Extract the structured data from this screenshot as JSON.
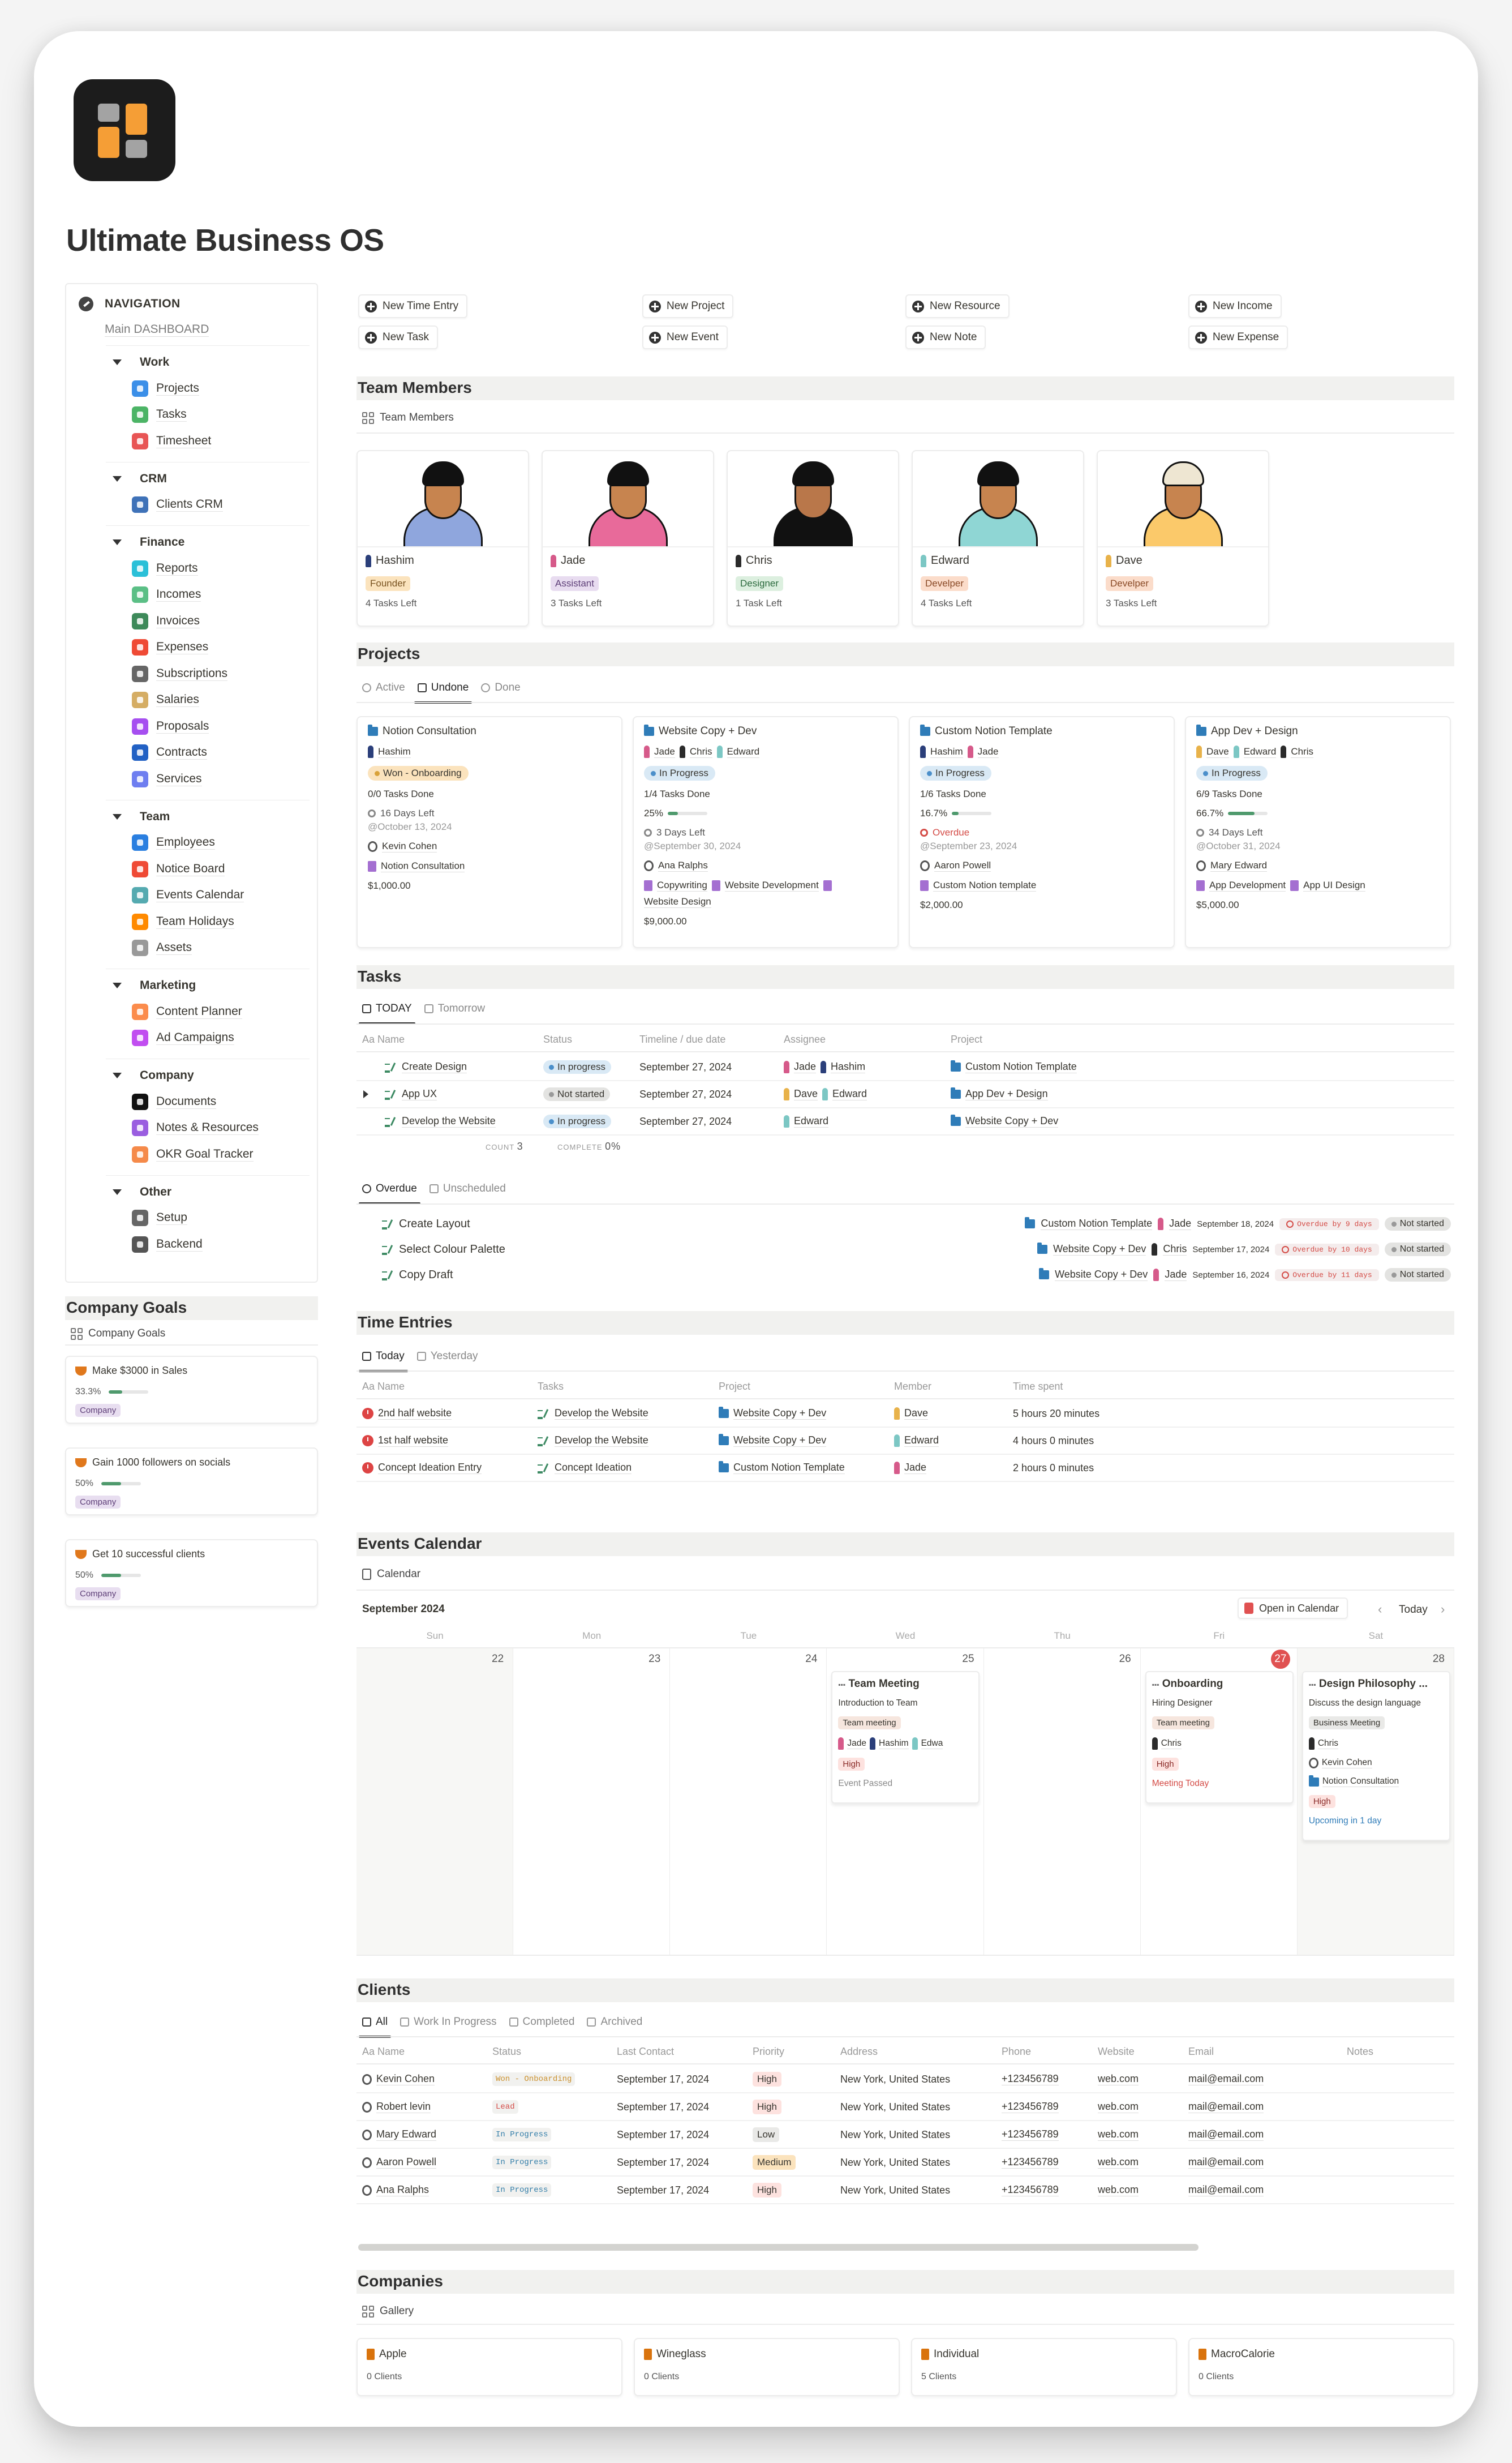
{
  "page": {
    "title": "Ultimate Business OS"
  },
  "navigation": {
    "heading": "NAVIGATION",
    "subtitle": "Main DASHBOARD",
    "groups": [
      {
        "title": "Work",
        "items": [
          {
            "label": "Projects",
            "icon": "projects-icon",
            "color": "#3b8fe8"
          },
          {
            "label": "Tasks",
            "icon": "tasks-icon",
            "color": "#4cb466"
          },
          {
            "label": "Timesheet",
            "icon": "timesheet-icon",
            "color": "#e85555"
          }
        ]
      },
      {
        "title": "CRM",
        "items": [
          {
            "label": "Clients CRM",
            "icon": "clients-icon",
            "color": "#3f72b8"
          }
        ]
      },
      {
        "title": "Finance",
        "items": [
          {
            "label": "Reports",
            "icon": "reports-icon",
            "color": "#2bc0d8"
          },
          {
            "label": "Incomes",
            "icon": "incomes-icon",
            "color": "#5bbf86"
          },
          {
            "label": "Invoices",
            "icon": "invoices-icon",
            "color": "#3e8a5a"
          },
          {
            "label": "Expenses",
            "icon": "expenses-icon",
            "color": "#ef4a35"
          },
          {
            "label": "Subscriptions",
            "icon": "subscriptions-icon",
            "color": "#666666"
          },
          {
            "label": "Salaries",
            "icon": "salaries-icon",
            "color": "#d5ad64"
          },
          {
            "label": "Proposals",
            "icon": "proposals-icon",
            "color": "#a64ff0"
          },
          {
            "label": "Contracts",
            "icon": "contracts-icon",
            "color": "#2261c4"
          },
          {
            "label": "Services",
            "icon": "services-icon",
            "color": "#6e7ef0"
          }
        ]
      },
      {
        "title": "Team",
        "items": [
          {
            "label": "Employees",
            "icon": "employees-icon",
            "color": "#2a7fe0"
          },
          {
            "label": "Notice Board",
            "icon": "notice-board-icon",
            "color": "#ef4a35"
          },
          {
            "label": "Events Calendar",
            "icon": "events-calendar-icon",
            "color": "#55aab0"
          },
          {
            "label": "Team Holidays",
            "icon": "team-holidays-icon",
            "color": "#ff8a00"
          },
          {
            "label": "Assets",
            "icon": "assets-icon",
            "color": "#999999"
          }
        ]
      },
      {
        "title": "Marketing",
        "items": [
          {
            "label": "Content Planner",
            "icon": "content-planner-icon",
            "color": "#fb8c4c"
          },
          {
            "label": "Ad Campaigns",
            "icon": "ad-campaigns-icon",
            "color": "#c14ef0"
          }
        ]
      },
      {
        "title": "Company",
        "items": [
          {
            "label": "Documents",
            "icon": "documents-icon",
            "color": "#111111"
          },
          {
            "label": "Notes & Resources",
            "icon": "notes-resources-icon",
            "color": "#9a5ee0"
          },
          {
            "label": "OKR Goal Tracker",
            "icon": "okr-goal-tracker-icon",
            "color": "#f58a4a"
          }
        ]
      },
      {
        "title": "Other",
        "items": [
          {
            "label": "Setup",
            "icon": "setup-icon",
            "color": "#666666"
          },
          {
            "label": "Backend",
            "icon": "database-icon",
            "color": "#555555"
          }
        ]
      }
    ]
  },
  "goals": {
    "title": "Company Goals",
    "view": "Company Goals",
    "items": [
      {
        "label": "Make $3000 in Sales",
        "percent_text": "33.3%",
        "progress": 0.333,
        "tag": "Company"
      },
      {
        "label": "Gain 1000 followers on socials",
        "percent_text": "50%",
        "progress": 0.5,
        "tag": "Company"
      },
      {
        "label": "Get 10 successful clients",
        "percent_text": "50%",
        "progress": 0.5,
        "tag": "Company"
      }
    ]
  },
  "quick_actions": [
    [
      "New Time Entry",
      "New Task"
    ],
    [
      "New Project",
      "New Event"
    ],
    [
      "New Resource",
      "New Note"
    ],
    [
      "New Income",
      "New Expense"
    ]
  ],
  "team": {
    "title": "Team Members",
    "view": "Team Members",
    "members": [
      {
        "name": "Hashim",
        "role": "Founder",
        "role_bg": "#fbe3bd",
        "role_fg": "#7a5422",
        "tasks": "4 Tasks Left",
        "shirt": "#8fa6dd",
        "skin": "#c7844f",
        "hair": "#111"
      },
      {
        "name": "Jade",
        "role": "Assistant",
        "role_bg": "#e8dcf0",
        "role_fg": "#5e3f78",
        "tasks": "3 Tasks Left",
        "shirt": "#e86a9a",
        "skin": "#c7844f",
        "hair": "#111"
      },
      {
        "name": "Chris",
        "role": "Designer",
        "role_bg": "#dcefdf",
        "role_fg": "#2d6b3f",
        "tasks": "1 Task Left",
        "shirt": "#111",
        "skin": "#b9774a",
        "hair": "#111"
      },
      {
        "name": "Edward",
        "role": "Develper",
        "role_bg": "#fbdcca",
        "role_fg": "#8a4a27",
        "tasks": "4 Tasks Left",
        "shirt": "#8fd6d4",
        "skin": "#c7844f",
        "hair": "#111"
      },
      {
        "name": "Dave",
        "role": "Develper",
        "role_bg": "#fbdcca",
        "role_fg": "#8a4a27",
        "tasks": "3 Tasks Left",
        "shirt": "#fbc96a",
        "skin": "#c7844f",
        "hair": "#eee6d2"
      }
    ]
  },
  "projects": {
    "title": "Projects",
    "tabs": [
      "Active",
      "Undone",
      "Done"
    ],
    "active_tab": "Undone",
    "cards": [
      {
        "name": "Notion Consultation",
        "people": [
          "Hashim"
        ],
        "status": "Won - Onboarding",
        "status_bg": "#fbe3bd",
        "status_dot": "#d9a23a",
        "tasks_done": "0/0 Tasks Done",
        "progress": null,
        "deadline": "16 Days Left",
        "deadline_red": false,
        "date": "@October 13, 2024",
        "client": "Kevin Cohen",
        "services": [
          "Notion Consultation"
        ],
        "amount": "$1,000.00"
      },
      {
        "name": "Website Copy + Dev",
        "people": [
          "Jade",
          "Chris",
          "Edward"
        ],
        "status": "In Progress",
        "status_bg": "#d9e9f5",
        "status_dot": "#4b8fca",
        "tasks_done": "1/4 Tasks Done",
        "progress_text": "25%",
        "progress": 0.25,
        "deadline": "3 Days Left",
        "deadline_red": false,
        "date": "@September 30, 2024",
        "client": "Ana Ralphs",
        "services": [
          "Copywriting",
          "Website Development",
          "Website Design"
        ],
        "amount": "$9,000.00"
      },
      {
        "name": "Custom Notion Template",
        "people": [
          "Hashim",
          "Jade"
        ],
        "status": "In Progress",
        "status_bg": "#d9e9f5",
        "status_dot": "#4b8fca",
        "tasks_done": "1/6 Tasks Done",
        "progress_text": "16.7%",
        "progress": 0.167,
        "deadline": "Overdue",
        "deadline_red": true,
        "date": "@September 23, 2024",
        "client": "Aaron Powell",
        "services": [
          "Custom Notion template"
        ],
        "amount": "$2,000.00"
      },
      {
        "name": "App Dev + Design",
        "people": [
          "Dave",
          "Edward",
          "Chris"
        ],
        "status": "In Progress",
        "status_bg": "#d9e9f5",
        "status_dot": "#4b8fca",
        "tasks_done": "6/9 Tasks Done",
        "progress_text": "66.7%",
        "progress": 0.667,
        "deadline": "34 Days Left",
        "deadline_red": false,
        "date": "@October 31, 2024",
        "client": "Mary Edward",
        "services": [
          "App Development",
          "App UI Design"
        ],
        "amount": "$5,000.00"
      }
    ]
  },
  "tasks": {
    "title": "Tasks",
    "tabs": [
      "TODAY",
      "Tomorrow"
    ],
    "columns": [
      "Aa Name",
      "Status",
      "Timeline / due date",
      "Assignee",
      "Project"
    ],
    "rows": [
      {
        "name": "Create Design",
        "status": "In progress",
        "status_kind": "progress",
        "date": "September 27, 2024",
        "assignees": [
          "Jade",
          "Hashim"
        ],
        "project": "Custom Notion Template",
        "expandable": false
      },
      {
        "name": "App UX",
        "status": "Not started",
        "status_kind": "not",
        "date": "September 27, 2024",
        "assignees": [
          "Dave",
          "Edward"
        ],
        "project": "App Dev + Design",
        "expandable": true
      },
      {
        "name": "Develop the Website",
        "status": "In progress",
        "status_kind": "progress",
        "date": "September 27, 2024",
        "assignees": [
          "Edward"
        ],
        "project": "Website Copy + Dev",
        "expandable": false
      }
    ],
    "count_label": "COUNT",
    "count": "3",
    "complete_label": "COMPLETE",
    "complete": "0%",
    "overdue_tabs": [
      "Overdue",
      "Unscheduled"
    ],
    "overdue_rows": [
      {
        "name": "Create Layout",
        "project": "Custom Notion Template",
        "assignee": "Jade",
        "date": "September 18, 2024",
        "overdue": "Overdue by 9 days",
        "status": "Not started"
      },
      {
        "name": "Select Colour Palette",
        "project": "Website Copy + Dev",
        "assignee": "Chris",
        "date": "September 17, 2024",
        "overdue": "Overdue by 10 days",
        "status": "Not started"
      },
      {
        "name": "Copy Draft",
        "project": "Website Copy + Dev",
        "assignee": "Jade",
        "date": "September 16, 2024",
        "overdue": "Overdue by 11 days",
        "status": "Not started"
      }
    ]
  },
  "time_entries": {
    "title": "Time Entries",
    "tabs": [
      "Today",
      "Yesterday"
    ],
    "columns": [
      "Aa Name",
      "Tasks",
      "Project",
      "Member",
      "Time spent"
    ],
    "rows": [
      {
        "name": "2nd half website",
        "task": "Develop the Website",
        "project": "Website Copy + Dev",
        "member": "Dave",
        "time": "5 hours 20 minutes"
      },
      {
        "name": "1st half website",
        "task": "Develop the Website",
        "project": "Website Copy + Dev",
        "member": "Edward",
        "time": "4 hours 0 minutes"
      },
      {
        "name": "Concept Ideation Entry",
        "task": "Concept Ideation",
        "project": "Custom Notion Template",
        "member": "Jade",
        "time": "2 hours 0 minutes"
      }
    ]
  },
  "calendar": {
    "title": "Events Calendar",
    "view": "Calendar",
    "month": "September 2024",
    "open_label": "Open in Calendar",
    "today_label": "Today",
    "weekdays": [
      "Sun",
      "Mon",
      "Tue",
      "Wed",
      "Thu",
      "Fri",
      "Sat"
    ],
    "days": [
      "22",
      "23",
      "24",
      "25",
      "26",
      "27",
      "28"
    ],
    "today_index": 5,
    "events": [
      {
        "day_index": 3,
        "title": "Team Meeting",
        "desc": "Introduction to Team",
        "type": "Team meeting",
        "type_bg": "#f6e6de",
        "people": [
          "Jade",
          "Hashim",
          "Edwa"
        ],
        "extra": [],
        "priority": "High",
        "note": "Event Passed",
        "note_color": "#888"
      },
      {
        "day_index": 5,
        "title": "Onboarding",
        "desc": "Hiring Designer",
        "type": "Team meeting",
        "type_bg": "#f6e6de",
        "people": [
          "Chris"
        ],
        "extra": [],
        "priority": "High",
        "note": "Meeting Today",
        "note_color": "#d44c47"
      },
      {
        "day_index": 6,
        "title": "Design Philosophy ...",
        "desc": "Discuss the design language",
        "type": "Business Meeting",
        "type_bg": "#e9e9e7",
        "people": [
          "Chris"
        ],
        "extra": [
          "Kevin Cohen",
          "Notion Consultation"
        ],
        "priority": "High",
        "note": "Upcoming in 1 day",
        "note_color": "#2f7cb8"
      }
    ]
  },
  "clients": {
    "title": "Clients",
    "tabs": [
      "All",
      "Work In Progress",
      "Completed",
      "Archived"
    ],
    "columns": [
      "Aa Name",
      "Status",
      "Last Contact",
      "Priority",
      "Address",
      "Phone",
      "Website",
      "Email",
      "Notes"
    ],
    "rows": [
      {
        "name": "Kevin Cohen",
        "status": "Won - Onboarding",
        "status_color": "#cb912f",
        "date": "September 17, 2024",
        "priority": "High",
        "priority_bg": "#fde2df",
        "address": "New York, United States",
        "phone": "+123456789",
        "website": "web.com",
        "email": "mail@email.com"
      },
      {
        "name": "Robert levin",
        "status": "Lead",
        "status_color": "#d44c47",
        "date": "September 17, 2024",
        "priority": "High",
        "priority_bg": "#fde2df",
        "address": "New York, United States",
        "phone": "+123456789",
        "website": "web.com",
        "email": "mail@email.com"
      },
      {
        "name": "Mary Edward",
        "status": "In Progress",
        "status_color": "#337ea9",
        "date": "September 17, 2024",
        "priority": "Low",
        "priority_bg": "#e9e9e7",
        "address": "New York, United States",
        "phone": "+123456789",
        "website": "web.com",
        "email": "mail@email.com"
      },
      {
        "name": "Aaron Powell",
        "status": "In Progress",
        "status_color": "#337ea9",
        "date": "September 17, 2024",
        "priority": "Medium",
        "priority_bg": "#fbe3bd",
        "address": "New York, United States",
        "phone": "+123456789",
        "website": "web.com",
        "email": "mail@email.com"
      },
      {
        "name": "Ana Ralphs",
        "status": "In Progress",
        "status_color": "#337ea9",
        "date": "September 17, 2024",
        "priority": "High",
        "priority_bg": "#fde2df",
        "address": "New York, United States",
        "phone": "+123456789",
        "website": "web.com",
        "email": "mail@email.com"
      }
    ]
  },
  "companies": {
    "title": "Companies",
    "view": "Gallery",
    "items": [
      {
        "name": "Apple",
        "clients": "0 Clients"
      },
      {
        "name": "Wineglass",
        "clients": "0 Clients"
      },
      {
        "name": "Individual",
        "clients": "5 Clients"
      },
      {
        "name": "MacroCalorie",
        "clients": "0 Clients"
      }
    ]
  },
  "person_colors": {
    "Hashim": "#2b3f7a",
    "Jade": "#d65a8a",
    "Chris": "#2b2b2b",
    "Edward": "#7cc7c4",
    "Dave": "#e8b24a",
    "Edwa": "#7cc7c4"
  }
}
